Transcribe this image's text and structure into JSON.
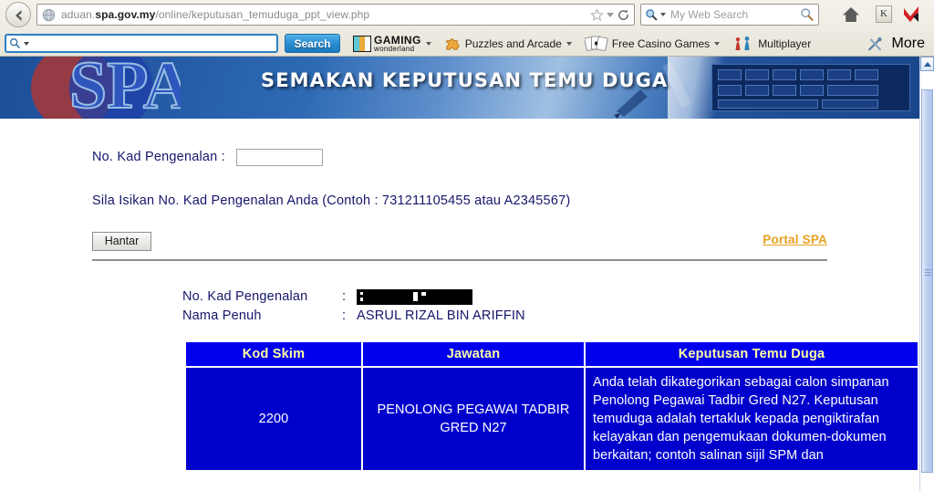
{
  "browser": {
    "url_prefix": "aduan.",
    "url_domain": "spa.gov.my",
    "url_path": "/online/keputusan_temuduga_ppt_view.php",
    "url_full": "aduan.spa.gov.my/online/keputusan_temuduga_ppt_view.php",
    "search_placeholder": "My Web Search",
    "k_button_label": "K"
  },
  "toolbar": {
    "search_value": "",
    "search_button_label": "Search",
    "items": [
      {
        "label_top": "GAMING",
        "label_sub": "wonderland",
        "icon": "gaming-wonderland-logo"
      },
      {
        "label": "Puzzles and Arcade",
        "icon": "puzzle-piece-icon"
      },
      {
        "label": "Free Casino Games",
        "icon": "playing-cards-icon"
      },
      {
        "label": "Multiplayer",
        "icon": "game-pawns-icon"
      }
    ],
    "more_label": "More",
    "tools_icon": "wrench-screwdriver-icon"
  },
  "banner": {
    "title": "SEMAKAN KEPUTUSAN TEMU DUGA",
    "logo_text": "SPA"
  },
  "form": {
    "ic_label": "No. Kad Pengenalan  :",
    "ic_value": "",
    "ic_placeholder": "",
    "hint": "Sila Isikan No. Kad Pengenalan Anda (Contoh : 731211105455 atau A2345567)",
    "submit_label": "Hantar",
    "portal_link_label": "Portal SPA"
  },
  "identity": {
    "rows": [
      {
        "key": "No. Kad Pengenalan",
        "colon": ":",
        "value": "",
        "redacted": true
      },
      {
        "key": "Nama Penuh",
        "colon": ":",
        "value": "ASRUL RIZAL BIN ARIFFIN",
        "redacted": false
      }
    ]
  },
  "results": {
    "headers": [
      "Kod Skim",
      "Jawatan",
      "Keputusan Temu Duga"
    ],
    "rows": [
      {
        "kod_skim": "2200",
        "jawatan": "PENOLONG PEGAWAI TADBIR GRED N27",
        "keputusan": "Anda telah dikategorikan sebagai calon simpanan Penolong Pegawai Tadbir Gred N27. Keputusan temuduga adalah tertakluk kepada pengiktirafan kelayakan dan pengemukaan dokumen-dokumen berkaitan; contoh salinan sijil SPM dan"
      }
    ]
  },
  "colors": {
    "table_header_bg": "#0000ee",
    "table_header_text": "#ffffa0",
    "table_body_bg": "#0000cc",
    "table_body_text": "#ffffff",
    "page_text": "#16166b",
    "link_orange": "#e8a020",
    "toolbar_accent": "#2a8ed1"
  },
  "scrollbar": {
    "orientation": "vertical",
    "up_arrow": "chevron-up-icon"
  }
}
